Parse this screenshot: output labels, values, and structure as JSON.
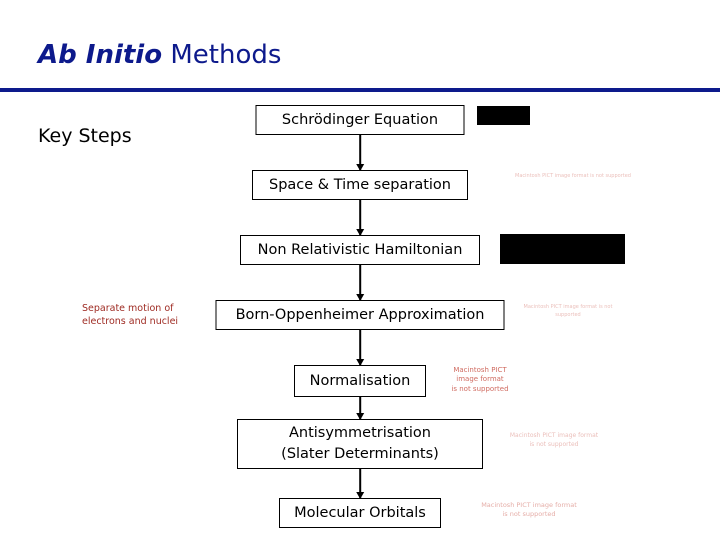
{
  "slide": {
    "title_italic": "Ab Initio",
    "title_regular": " Methods",
    "rule_color": "#0d1a8c",
    "title_color": "#0d1a8c",
    "section_label": "Key Steps"
  },
  "flowchart": {
    "type": "flowchart",
    "orientation": "vertical",
    "nodes": [
      {
        "id": "schrodinger",
        "label": "Schrödinger Equation"
      },
      {
        "id": "space-time",
        "label": "Space & Time separation"
      },
      {
        "id": "non-relativistic",
        "label": "Non Relativistic Hamiltonian"
      },
      {
        "id": "born-oppenheimer",
        "label": "Born-Oppenheimer Approximation"
      },
      {
        "id": "normalisation",
        "label": "Normalisation"
      },
      {
        "id": "antisymmetrisation",
        "label": "Antisymmetrisation\n(Slater Determinants)"
      },
      {
        "id": "molecular-orbitals",
        "label": "Molecular Orbitals"
      }
    ],
    "edges": [
      {
        "from": "schrodinger",
        "to": "space-time"
      },
      {
        "from": "space-time",
        "to": "non-relativistic"
      },
      {
        "from": "non-relativistic",
        "to": "born-oppenheimer"
      },
      {
        "from": "born-oppenheimer",
        "to": "normalisation"
      },
      {
        "from": "normalisation",
        "to": "antisymmetrisation"
      },
      {
        "from": "antisymmetrisation",
        "to": "molecular-orbitals"
      }
    ]
  },
  "annotations": {
    "separate_motion": "Separate motion of\nelectrons and nuclei",
    "separate_motion_color": "#9e2a22"
  },
  "placeholders": {
    "message": "Macintosh PICT\nimage format\nis not supported",
    "color": "#c0392b",
    "items": [
      {
        "id": "placeholder-space-time",
        "text": "Macintosh PICT image format is not supported"
      },
      {
        "id": "placeholder-born-oppenheimer",
        "text": "Macintosh PICT image format is not supported"
      },
      {
        "id": "placeholder-normalisation",
        "text": "Macintosh PICT\nimage format\nis not supported"
      },
      {
        "id": "placeholder-antisymmetrisation",
        "text": "Macintosh PICT image format\nis not supported"
      },
      {
        "id": "placeholder-molecular-orbitals",
        "text": "Macintosh PICT image format\nis not supported"
      }
    ]
  },
  "redactions": [
    {
      "id": "redaction-schrodinger"
    },
    {
      "id": "redaction-hamiltonian"
    }
  ]
}
